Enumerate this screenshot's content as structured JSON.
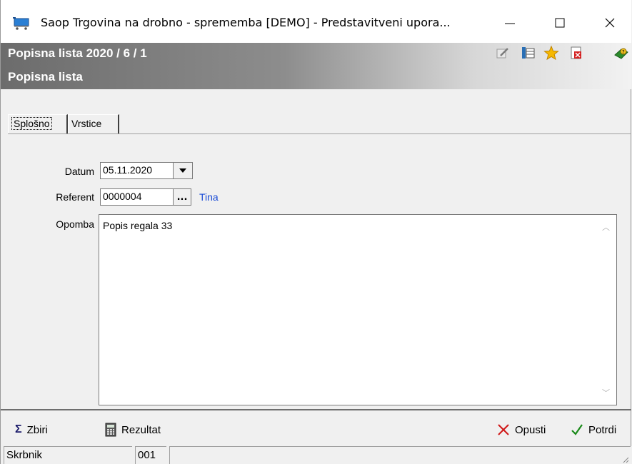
{
  "window": {
    "title": "Saop Trgovina na drobno - sprememba [DEMO] - Predstavitveni upora...",
    "controls": {
      "minimize": "—",
      "maximize": "☐",
      "close": "✕"
    }
  },
  "header": {
    "title_line1": "Popisna lista 2020 / 6 / 1",
    "title_line2": "Popisna lista",
    "icons": [
      "edit-icon",
      "table-icon",
      "star-icon",
      "close-document-icon",
      "help-book-icon"
    ]
  },
  "tabs": [
    {
      "label": "Splošno",
      "active": true
    },
    {
      "label": "Vrstice",
      "active": false
    }
  ],
  "form": {
    "datum_label": "Datum",
    "datum_value": "05.11.2020",
    "referent_label": "Referent",
    "referent_value": "0000004",
    "referent_browse": "...",
    "referent_name": "Tina",
    "opomba_label": "Opomba",
    "opomba_value": "Popis regala 33"
  },
  "toolbar": {
    "zbiri_label": "Zbiri",
    "rezultat_label": "Rezultat",
    "opusti_label": "Opusti",
    "potrdi_label": "Potrdi"
  },
  "statusbar": {
    "role": "Skrbnik",
    "code": "001"
  },
  "colors": {
    "link": "#1a4bd6",
    "cancel": "#d01818",
    "confirm": "#1a8a1a"
  }
}
